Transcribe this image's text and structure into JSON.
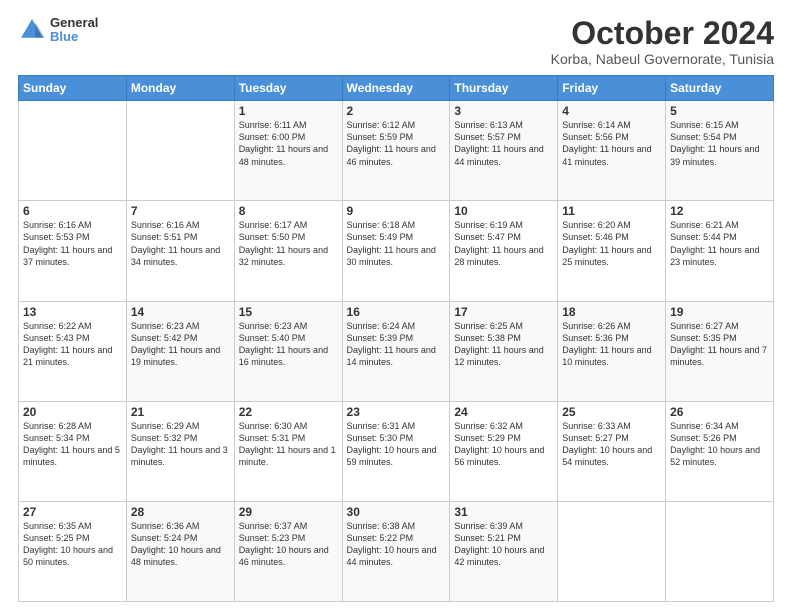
{
  "logo": {
    "line1": "General",
    "line2": "Blue"
  },
  "title": "October 2024",
  "subtitle": "Korba, Nabeul Governorate, Tunisia",
  "headers": [
    "Sunday",
    "Monday",
    "Tuesday",
    "Wednesday",
    "Thursday",
    "Friday",
    "Saturday"
  ],
  "weeks": [
    [
      {
        "day": "",
        "info": ""
      },
      {
        "day": "",
        "info": ""
      },
      {
        "day": "1",
        "info": "Sunrise: 6:11 AM\nSunset: 6:00 PM\nDaylight: 11 hours and 48 minutes."
      },
      {
        "day": "2",
        "info": "Sunrise: 6:12 AM\nSunset: 5:59 PM\nDaylight: 11 hours and 46 minutes."
      },
      {
        "day": "3",
        "info": "Sunrise: 6:13 AM\nSunset: 5:57 PM\nDaylight: 11 hours and 44 minutes."
      },
      {
        "day": "4",
        "info": "Sunrise: 6:14 AM\nSunset: 5:56 PM\nDaylight: 11 hours and 41 minutes."
      },
      {
        "day": "5",
        "info": "Sunrise: 6:15 AM\nSunset: 5:54 PM\nDaylight: 11 hours and 39 minutes."
      }
    ],
    [
      {
        "day": "6",
        "info": "Sunrise: 6:16 AM\nSunset: 5:53 PM\nDaylight: 11 hours and 37 minutes."
      },
      {
        "day": "7",
        "info": "Sunrise: 6:16 AM\nSunset: 5:51 PM\nDaylight: 11 hours and 34 minutes."
      },
      {
        "day": "8",
        "info": "Sunrise: 6:17 AM\nSunset: 5:50 PM\nDaylight: 11 hours and 32 minutes."
      },
      {
        "day": "9",
        "info": "Sunrise: 6:18 AM\nSunset: 5:49 PM\nDaylight: 11 hours and 30 minutes."
      },
      {
        "day": "10",
        "info": "Sunrise: 6:19 AM\nSunset: 5:47 PM\nDaylight: 11 hours and 28 minutes."
      },
      {
        "day": "11",
        "info": "Sunrise: 6:20 AM\nSunset: 5:46 PM\nDaylight: 11 hours and 25 minutes."
      },
      {
        "day": "12",
        "info": "Sunrise: 6:21 AM\nSunset: 5:44 PM\nDaylight: 11 hours and 23 minutes."
      }
    ],
    [
      {
        "day": "13",
        "info": "Sunrise: 6:22 AM\nSunset: 5:43 PM\nDaylight: 11 hours and 21 minutes."
      },
      {
        "day": "14",
        "info": "Sunrise: 6:23 AM\nSunset: 5:42 PM\nDaylight: 11 hours and 19 minutes."
      },
      {
        "day": "15",
        "info": "Sunrise: 6:23 AM\nSunset: 5:40 PM\nDaylight: 11 hours and 16 minutes."
      },
      {
        "day": "16",
        "info": "Sunrise: 6:24 AM\nSunset: 5:39 PM\nDaylight: 11 hours and 14 minutes."
      },
      {
        "day": "17",
        "info": "Sunrise: 6:25 AM\nSunset: 5:38 PM\nDaylight: 11 hours and 12 minutes."
      },
      {
        "day": "18",
        "info": "Sunrise: 6:26 AM\nSunset: 5:36 PM\nDaylight: 11 hours and 10 minutes."
      },
      {
        "day": "19",
        "info": "Sunrise: 6:27 AM\nSunset: 5:35 PM\nDaylight: 11 hours and 7 minutes."
      }
    ],
    [
      {
        "day": "20",
        "info": "Sunrise: 6:28 AM\nSunset: 5:34 PM\nDaylight: 11 hours and 5 minutes."
      },
      {
        "day": "21",
        "info": "Sunrise: 6:29 AM\nSunset: 5:32 PM\nDaylight: 11 hours and 3 minutes."
      },
      {
        "day": "22",
        "info": "Sunrise: 6:30 AM\nSunset: 5:31 PM\nDaylight: 11 hours and 1 minute."
      },
      {
        "day": "23",
        "info": "Sunrise: 6:31 AM\nSunset: 5:30 PM\nDaylight: 10 hours and 59 minutes."
      },
      {
        "day": "24",
        "info": "Sunrise: 6:32 AM\nSunset: 5:29 PM\nDaylight: 10 hours and 56 minutes."
      },
      {
        "day": "25",
        "info": "Sunrise: 6:33 AM\nSunset: 5:27 PM\nDaylight: 10 hours and 54 minutes."
      },
      {
        "day": "26",
        "info": "Sunrise: 6:34 AM\nSunset: 5:26 PM\nDaylight: 10 hours and 52 minutes."
      }
    ],
    [
      {
        "day": "27",
        "info": "Sunrise: 6:35 AM\nSunset: 5:25 PM\nDaylight: 10 hours and 50 minutes."
      },
      {
        "day": "28",
        "info": "Sunrise: 6:36 AM\nSunset: 5:24 PM\nDaylight: 10 hours and 48 minutes."
      },
      {
        "day": "29",
        "info": "Sunrise: 6:37 AM\nSunset: 5:23 PM\nDaylight: 10 hours and 46 minutes."
      },
      {
        "day": "30",
        "info": "Sunrise: 6:38 AM\nSunset: 5:22 PM\nDaylight: 10 hours and 44 minutes."
      },
      {
        "day": "31",
        "info": "Sunrise: 6:39 AM\nSunset: 5:21 PM\nDaylight: 10 hours and 42 minutes."
      },
      {
        "day": "",
        "info": ""
      },
      {
        "day": "",
        "info": ""
      }
    ]
  ]
}
